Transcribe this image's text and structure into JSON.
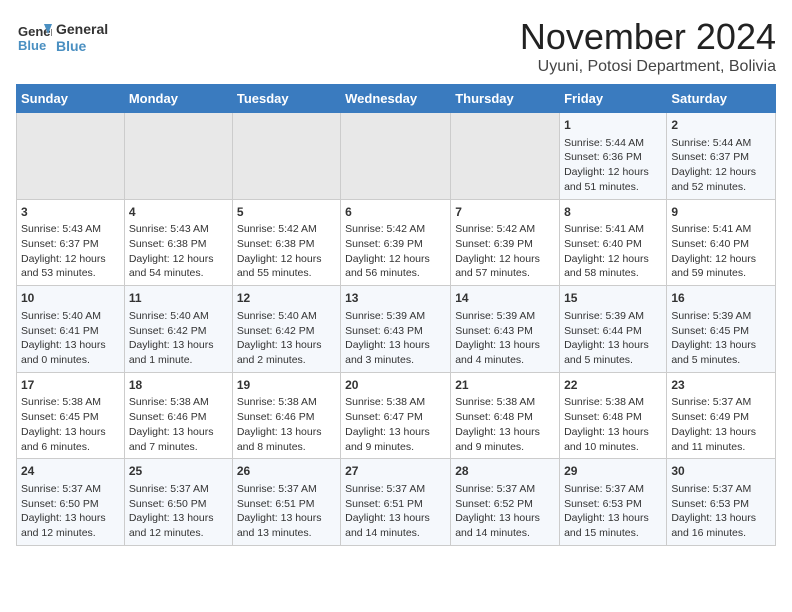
{
  "header": {
    "logo_line1": "General",
    "logo_line2": "Blue",
    "month": "November 2024",
    "location": "Uyuni, Potosi Department, Bolivia"
  },
  "days_of_week": [
    "Sunday",
    "Monday",
    "Tuesday",
    "Wednesday",
    "Thursday",
    "Friday",
    "Saturday"
  ],
  "weeks": [
    [
      {
        "day": "",
        "empty": true
      },
      {
        "day": "",
        "empty": true
      },
      {
        "day": "",
        "empty": true
      },
      {
        "day": "",
        "empty": true
      },
      {
        "day": "",
        "empty": true
      },
      {
        "day": "1",
        "sunrise": "5:44 AM",
        "sunset": "6:36 PM",
        "daylight": "12 hours and 51 minutes."
      },
      {
        "day": "2",
        "sunrise": "5:44 AM",
        "sunset": "6:37 PM",
        "daylight": "12 hours and 52 minutes."
      }
    ],
    [
      {
        "day": "3",
        "sunrise": "5:43 AM",
        "sunset": "6:37 PM",
        "daylight": "12 hours and 53 minutes."
      },
      {
        "day": "4",
        "sunrise": "5:43 AM",
        "sunset": "6:38 PM",
        "daylight": "12 hours and 54 minutes."
      },
      {
        "day": "5",
        "sunrise": "5:42 AM",
        "sunset": "6:38 PM",
        "daylight": "12 hours and 55 minutes."
      },
      {
        "day": "6",
        "sunrise": "5:42 AM",
        "sunset": "6:39 PM",
        "daylight": "12 hours and 56 minutes."
      },
      {
        "day": "7",
        "sunrise": "5:42 AM",
        "sunset": "6:39 PM",
        "daylight": "12 hours and 57 minutes."
      },
      {
        "day": "8",
        "sunrise": "5:41 AM",
        "sunset": "6:40 PM",
        "daylight": "12 hours and 58 minutes."
      },
      {
        "day": "9",
        "sunrise": "5:41 AM",
        "sunset": "6:40 PM",
        "daylight": "12 hours and 59 minutes."
      }
    ],
    [
      {
        "day": "10",
        "sunrise": "5:40 AM",
        "sunset": "6:41 PM",
        "daylight": "13 hours and 0 minutes."
      },
      {
        "day": "11",
        "sunrise": "5:40 AM",
        "sunset": "6:42 PM",
        "daylight": "13 hours and 1 minute."
      },
      {
        "day": "12",
        "sunrise": "5:40 AM",
        "sunset": "6:42 PM",
        "daylight": "13 hours and 2 minutes."
      },
      {
        "day": "13",
        "sunrise": "5:39 AM",
        "sunset": "6:43 PM",
        "daylight": "13 hours and 3 minutes."
      },
      {
        "day": "14",
        "sunrise": "5:39 AM",
        "sunset": "6:43 PM",
        "daylight": "13 hours and 4 minutes."
      },
      {
        "day": "15",
        "sunrise": "5:39 AM",
        "sunset": "6:44 PM",
        "daylight": "13 hours and 5 minutes."
      },
      {
        "day": "16",
        "sunrise": "5:39 AM",
        "sunset": "6:45 PM",
        "daylight": "13 hours and 5 minutes."
      }
    ],
    [
      {
        "day": "17",
        "sunrise": "5:38 AM",
        "sunset": "6:45 PM",
        "daylight": "13 hours and 6 minutes."
      },
      {
        "day": "18",
        "sunrise": "5:38 AM",
        "sunset": "6:46 PM",
        "daylight": "13 hours and 7 minutes."
      },
      {
        "day": "19",
        "sunrise": "5:38 AM",
        "sunset": "6:46 PM",
        "daylight": "13 hours and 8 minutes."
      },
      {
        "day": "20",
        "sunrise": "5:38 AM",
        "sunset": "6:47 PM",
        "daylight": "13 hours and 9 minutes."
      },
      {
        "day": "21",
        "sunrise": "5:38 AM",
        "sunset": "6:48 PM",
        "daylight": "13 hours and 9 minutes."
      },
      {
        "day": "22",
        "sunrise": "5:38 AM",
        "sunset": "6:48 PM",
        "daylight": "13 hours and 10 minutes."
      },
      {
        "day": "23",
        "sunrise": "5:37 AM",
        "sunset": "6:49 PM",
        "daylight": "13 hours and 11 minutes."
      }
    ],
    [
      {
        "day": "24",
        "sunrise": "5:37 AM",
        "sunset": "6:50 PM",
        "daylight": "13 hours and 12 minutes."
      },
      {
        "day": "25",
        "sunrise": "5:37 AM",
        "sunset": "6:50 PM",
        "daylight": "13 hours and 12 minutes."
      },
      {
        "day": "26",
        "sunrise": "5:37 AM",
        "sunset": "6:51 PM",
        "daylight": "13 hours and 13 minutes."
      },
      {
        "day": "27",
        "sunrise": "5:37 AM",
        "sunset": "6:51 PM",
        "daylight": "13 hours and 14 minutes."
      },
      {
        "day": "28",
        "sunrise": "5:37 AM",
        "sunset": "6:52 PM",
        "daylight": "13 hours and 14 minutes."
      },
      {
        "day": "29",
        "sunrise": "5:37 AM",
        "sunset": "6:53 PM",
        "daylight": "13 hours and 15 minutes."
      },
      {
        "day": "30",
        "sunrise": "5:37 AM",
        "sunset": "6:53 PM",
        "daylight": "13 hours and 16 minutes."
      }
    ]
  ],
  "labels": {
    "sunrise": "Sunrise:",
    "sunset": "Sunset:",
    "daylight": "Daylight:"
  }
}
